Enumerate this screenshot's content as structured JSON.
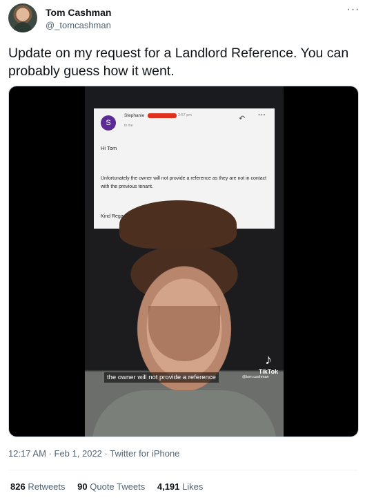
{
  "author": {
    "name": "Tom Cashman",
    "handle": "@_tomcashman"
  },
  "tweet": {
    "text": "Update on my request for a Landlord Reference. You can probably guess how it went."
  },
  "media": {
    "email": {
      "avatar_letter": "S",
      "sender": "Stephanie",
      "time": "2:57 pm",
      "to": "to me",
      "greeting": "Hi Tom",
      "body": "Unfortunately the owner will not provide a reference as they are not in contact with the previous tenant.",
      "signoff": "Kind Regards"
    },
    "caption": "the owner will not provide a reference",
    "tiktok_label": "TikTok",
    "tiktok_handle": "@tom.cashman"
  },
  "meta": {
    "time": "12:17 AM",
    "date": "Feb 1, 2022",
    "source": "Twitter for iPhone"
  },
  "stats": {
    "retweets_count": "826",
    "retweets_label": "Retweets",
    "quotes_count": "90",
    "quotes_label": "Quote Tweets",
    "likes_count": "4,191",
    "likes_label": "Likes"
  },
  "colors": {
    "secondary_text": "#536471",
    "primary_text": "#0f1419",
    "email_avatar": "#5b2b96",
    "redaction": "#e0301e"
  }
}
